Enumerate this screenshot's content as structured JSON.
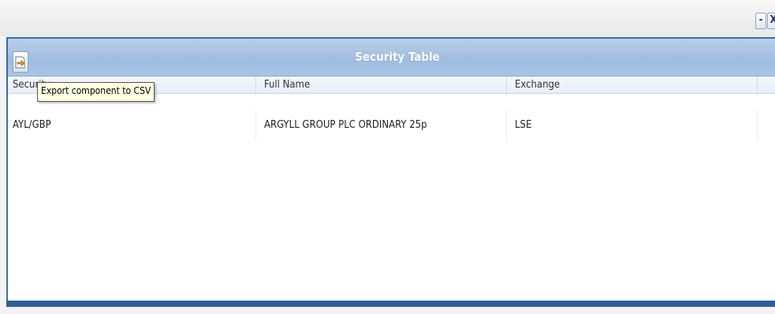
{
  "window": {
    "minimize_label": "-",
    "close_label": "X"
  },
  "panel": {
    "title": "Security Table",
    "export_icon": "export-csv-icon"
  },
  "tooltip": {
    "text": "Export component to CSV"
  },
  "table": {
    "columns": [
      "Security",
      "Full Name",
      "Exchange"
    ],
    "rows": [
      [
        "AYL/GBP",
        "ARGYLL GROUP PLC ORDINARY 25p",
        "LSE"
      ]
    ]
  },
  "colors": {
    "panel_border": "#3a6aa6",
    "title_bar": "#a9c5e4",
    "tooltip_bg": "#ffffe1"
  }
}
